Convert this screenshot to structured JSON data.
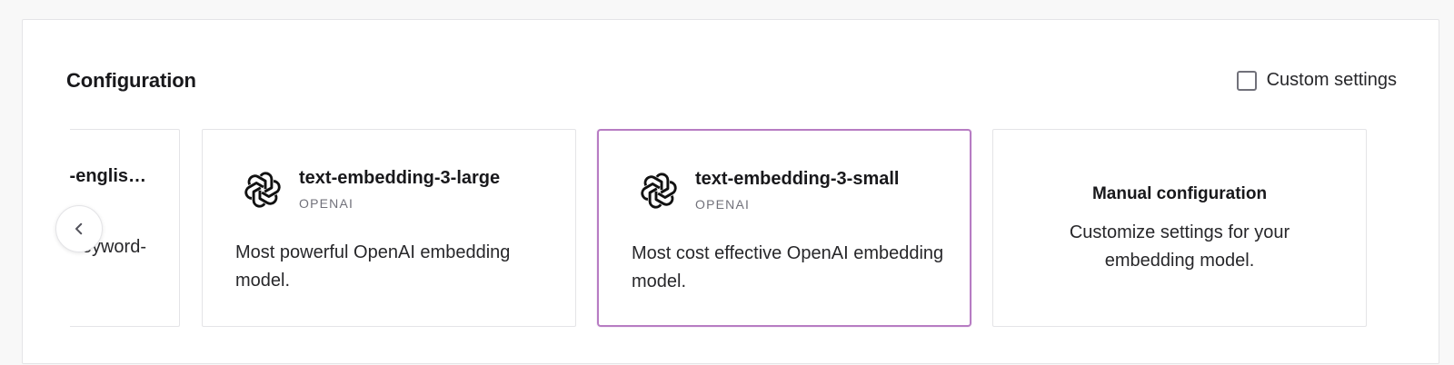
{
  "section": {
    "title": "Configuration"
  },
  "custom_settings": {
    "label": "Custom settings",
    "checked": false
  },
  "cards": {
    "partial": {
      "name": "-englis…",
      "desc": "eyword-"
    },
    "large": {
      "name": "text-embedding-3-large",
      "provider": "OPENAI",
      "desc": "Most powerful OpenAI embedding model.",
      "icon": "openai-logo-icon"
    },
    "small": {
      "name": "text-embedding-3-small",
      "provider": "OPENAI",
      "desc": "Most cost effective OpenAI embedding model.",
      "icon": "openai-logo-icon",
      "selected": true
    },
    "manual": {
      "title": "Manual configuration",
      "desc": "Customize settings for your embedding model."
    }
  },
  "carousel": {
    "prev_icon": "chevron-left-icon"
  },
  "colors": {
    "selected_border": "#b77cc3",
    "card_border": "#e4e4e7",
    "page_bg": "#f8f8f8"
  }
}
